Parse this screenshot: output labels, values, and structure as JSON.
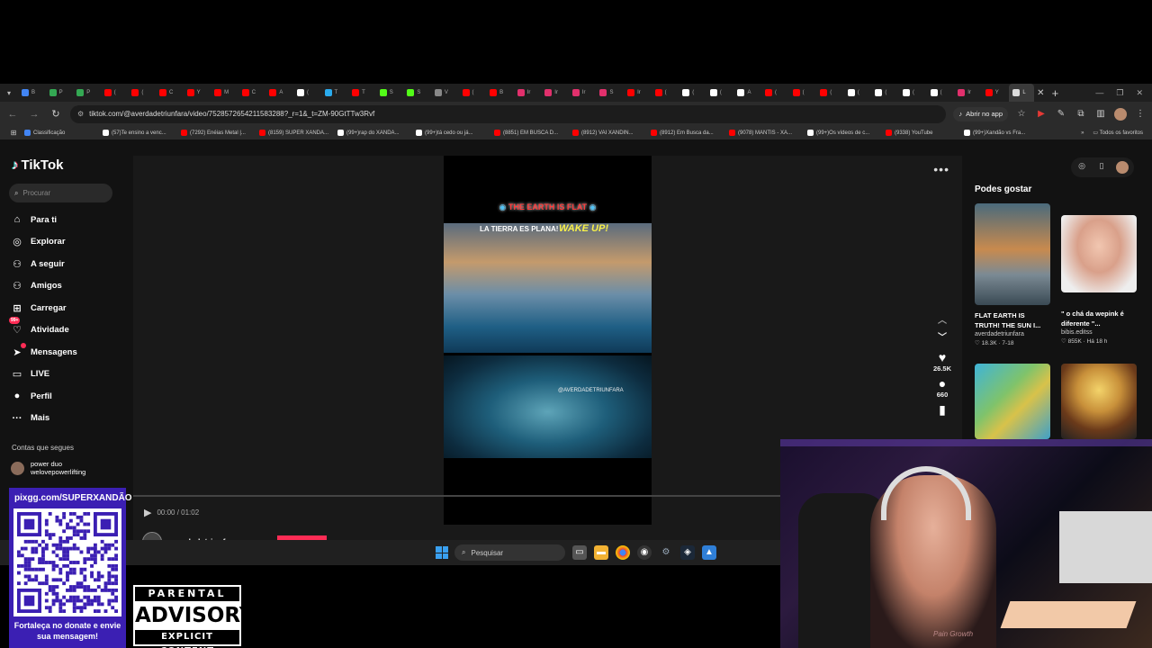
{
  "browser": {
    "tabs": [
      {
        "label": "B",
        "color": "#4285f4"
      },
      {
        "label": "P",
        "color": "#34a853"
      },
      {
        "label": "P",
        "color": "#34a853"
      },
      {
        "label": "(",
        "color": "#ff0000"
      },
      {
        "label": "(",
        "color": "#ff0000"
      },
      {
        "label": "C",
        "color": "#ff0000"
      },
      {
        "label": "Y",
        "color": "#ff0000"
      },
      {
        "label": "M",
        "color": "#ff0000"
      },
      {
        "label": "C",
        "color": "#ff0000"
      },
      {
        "label": "A",
        "color": "#ff0000"
      },
      {
        "label": "(",
        "color": "#ffffff"
      },
      {
        "label": "T",
        "color": "#2aabee"
      },
      {
        "label": "T",
        "color": "#ff0000"
      },
      {
        "label": "S",
        "color": "#53fc18"
      },
      {
        "label": "S",
        "color": "#53fc18"
      },
      {
        "label": "V",
        "color": "#888888"
      },
      {
        "label": "(",
        "color": "#ff0000"
      },
      {
        "label": "B",
        "color": "#ff0000"
      },
      {
        "label": "Ir",
        "color": "#e1306c"
      },
      {
        "label": "Ir",
        "color": "#e1306c"
      },
      {
        "label": "Ir",
        "color": "#e1306c"
      },
      {
        "label": "S",
        "color": "#e1306c"
      },
      {
        "label": "Ir",
        "color": "#ff0000"
      },
      {
        "label": "(",
        "color": "#ff0000"
      },
      {
        "label": "(",
        "color": "#ffffff"
      },
      {
        "label": "(",
        "color": "#ffffff"
      },
      {
        "label": "A",
        "color": "#ffffff"
      },
      {
        "label": "(",
        "color": "#ff0000"
      },
      {
        "label": "(",
        "color": "#ff0000"
      },
      {
        "label": "(",
        "color": "#ff0000"
      },
      {
        "label": "(",
        "color": "#ffffff"
      },
      {
        "label": "(",
        "color": "#ffffff"
      },
      {
        "label": "(",
        "color": "#ffffff"
      },
      {
        "label": "(",
        "color": "#ffffff"
      },
      {
        "label": "Ir",
        "color": "#e1306c"
      },
      {
        "label": "Y",
        "color": "#ff0000"
      }
    ],
    "active_tab": {
      "label": "L",
      "color": "#ffffff"
    },
    "url": "tiktok.com/@averdadetriunfara/video/7528572654211583288?_r=1&_t=ZM-90GtTTw3Rvf",
    "open_app_label": "Abrir no app",
    "bookmarks": [
      {
        "label": "Classificação",
        "color": "#4285f4"
      },
      {
        "label": "(57)Te ensino a venc...",
        "color": "#ffffff"
      },
      {
        "label": "(7292) Enéias Metal |...",
        "color": "#ff0000"
      },
      {
        "label": "(8159) SUPER XANDÃ...",
        "color": "#ff0000"
      },
      {
        "label": "(99+)rap do XANDÃ...",
        "color": "#ffffff"
      },
      {
        "label": "(99+)tá cedo ou já...",
        "color": "#ffffff"
      },
      {
        "label": "(8851) EM BUSCA D...",
        "color": "#ff0000"
      },
      {
        "label": "(8912) VAI XANDIN...",
        "color": "#ff0000"
      },
      {
        "label": "(8912) Em Busca da...",
        "color": "#ff0000"
      },
      {
        "label": "(9078) MANTIS - XA...",
        "color": "#ff0000"
      },
      {
        "label": "(99+)Os vídeos de c...",
        "color": "#ffffff"
      },
      {
        "label": "(9338) YouTube",
        "color": "#ff0000"
      },
      {
        "label": "(99+)Xandão vs Fra...",
        "color": "#ffffff"
      }
    ],
    "all_bookmarks": "Todos os favoritos"
  },
  "tiktok": {
    "logo": "TikTok",
    "search_placeholder": "Procurar",
    "nav": [
      {
        "label": "Para ti",
        "icon": "home-icon",
        "glyph": "⌂"
      },
      {
        "label": "Explorar",
        "icon": "compass-icon",
        "glyph": "◎"
      },
      {
        "label": "A seguir",
        "icon": "following-icon",
        "glyph": "⚇"
      },
      {
        "label": "Amigos",
        "icon": "friends-icon",
        "glyph": "⚇"
      },
      {
        "label": "Carregar",
        "icon": "upload-icon",
        "glyph": "⊞"
      },
      {
        "label": "Atividade",
        "icon": "activity-icon",
        "glyph": "♡",
        "badge": "99+"
      },
      {
        "label": "Mensagens",
        "icon": "messages-icon",
        "glyph": "➤",
        "dot": "3"
      },
      {
        "label": "LIVE",
        "icon": "live-icon",
        "glyph": "▭"
      },
      {
        "label": "Perfil",
        "icon": "profile-icon",
        "glyph": "●"
      },
      {
        "label": "Mais",
        "icon": "more-icon",
        "glyph": "···"
      }
    ],
    "following_title": "Contas que segues",
    "following": [
      {
        "name": "power duo",
        "handle": "welovepowerlifting"
      }
    ],
    "video": {
      "title": "THE EARTH IS FLAT",
      "subtitle_left": "LA TIERRA ES PLANA!",
      "subtitle_right": "WAKE UP!",
      "watermark": "@AVERDADETRIUNFARA",
      "time": "00:00 / 01:02",
      "author": "averdadetriunfara"
    },
    "actions": {
      "likes": "26.5K",
      "comments": "660"
    },
    "recs_title": "Podes gostar",
    "recs": [
      {
        "caption": "FLAT EARTH IS TRUTH! THE SUN I...",
        "author": "averdadetriunfara",
        "likes": "18.3K",
        "date": "7-18"
      },
      {
        "caption": "\" o chá da wepink é diferente \"...",
        "author": "bibis.editss",
        "likes": "855K",
        "date": "Há 18 h"
      }
    ]
  },
  "taskbar": {
    "search_placeholder": "Pesquisar"
  },
  "overlay": {
    "qr_url": "pixgg.com/SUPERXANDÃO",
    "qr_message": "Fortaleça no donate e envie sua mensagem!",
    "advisory_top": "PARENTAL",
    "advisory_mid": "ADVISORY",
    "advisory_bottom": "EXPLICIT CONTENT",
    "shirt_text": "Pain Growth"
  }
}
